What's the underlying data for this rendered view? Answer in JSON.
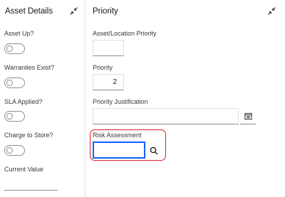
{
  "asset_details": {
    "title": "Asset Details",
    "fields": {
      "asset_up": {
        "label": "Asset Up?"
      },
      "warranties_exist": {
        "label": "Warranties Exist?"
      },
      "sla_applied": {
        "label": "SLA Applied?"
      },
      "charge_to_store": {
        "label": "Charge to Store?"
      },
      "current_value": {
        "label": "Current Value",
        "value": ""
      }
    }
  },
  "priority": {
    "title": "Priority",
    "fields": {
      "asset_location_priority": {
        "label": "Asset/Location Priority",
        "value": ""
      },
      "priority": {
        "label": "Priority",
        "value": "2"
      },
      "priority_justification": {
        "label": "Priority Justification",
        "value": ""
      },
      "risk_assessment": {
        "label": "Risk Assessment",
        "value": ""
      }
    }
  },
  "icons": {
    "collapse": "collapse-arrows-icon",
    "select_value": "list-select-icon",
    "lookup": "search-icon"
  },
  "colors": {
    "highlight": "#da1e28",
    "focus": "#0f62fe",
    "background": "#f4f4f4"
  }
}
